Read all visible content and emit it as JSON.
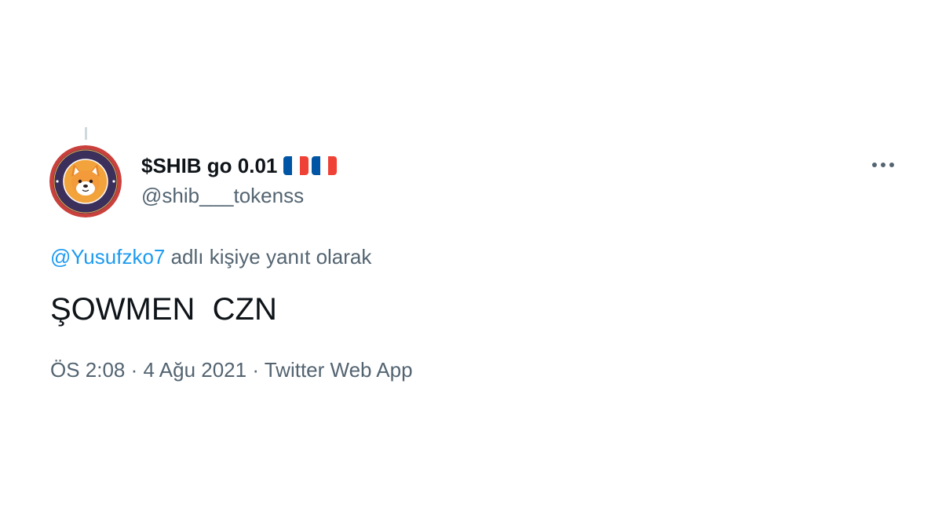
{
  "author": {
    "display_name": "$SHIB go 0.01",
    "flags": [
      "fr-flag",
      "fr-flag"
    ],
    "handle": "@shib___tokenss",
    "avatar_icon": "shiba-inu-avatar-icon"
  },
  "menu": {
    "more_icon": "more-horizontal-icon"
  },
  "reply": {
    "mention": "@Yusufzko7",
    "suffix": " adlı kişiye yanıt olarak"
  },
  "tweet": {
    "text": "ŞOWMEN  CZN"
  },
  "meta": {
    "time": "ÖS 2:08",
    "separator": " · ",
    "date": "4 Ağu 2021",
    "source": "Twitter Web App"
  },
  "colors": {
    "text_primary": "#0f1419",
    "text_secondary": "#536471",
    "link": "#1d9bf0",
    "flag_blue": "#0055a4",
    "flag_red": "#ef4135",
    "avatar_ring": "#d9534f"
  }
}
